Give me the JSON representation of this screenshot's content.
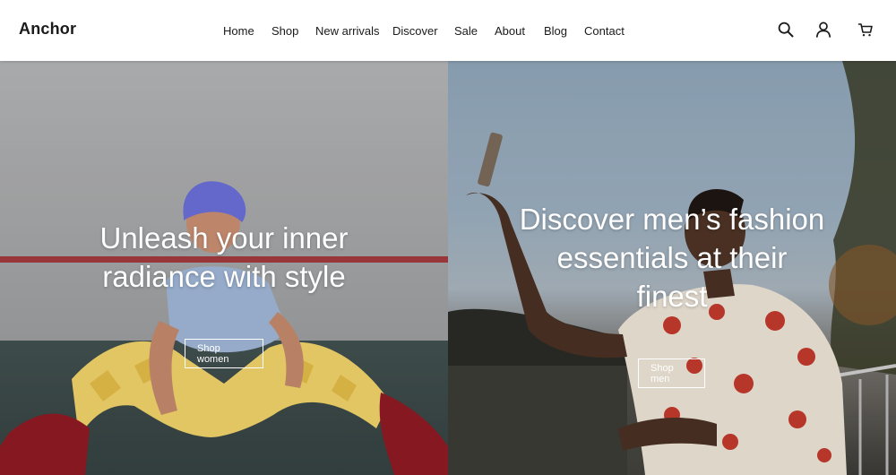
{
  "brand": {
    "name": "Anchor"
  },
  "nav": {
    "items": [
      {
        "label": "Home"
      },
      {
        "label": "Shop"
      },
      {
        "label": "New arrivals"
      },
      {
        "label": "Discover"
      },
      {
        "label": "Sale"
      },
      {
        "label": "About"
      },
      {
        "label": "Blog"
      },
      {
        "label": "Contact"
      }
    ]
  },
  "header_icons": [
    "search-icon",
    "account-icon",
    "cart-icon"
  ],
  "hero": {
    "left": {
      "headline_line1": "Unleash your inner",
      "headline_line2": "radiance with style",
      "button_label": "Shop women"
    },
    "right": {
      "headline_line1": "Discover men’s fashion",
      "headline_line2": "essentials at their",
      "headline_line3": "finest",
      "button_label": "Shop men"
    }
  },
  "colors": {
    "header_bg": "#ffffff",
    "text_dark": "#1a1a1a",
    "hero_text": "#ffffff"
  }
}
